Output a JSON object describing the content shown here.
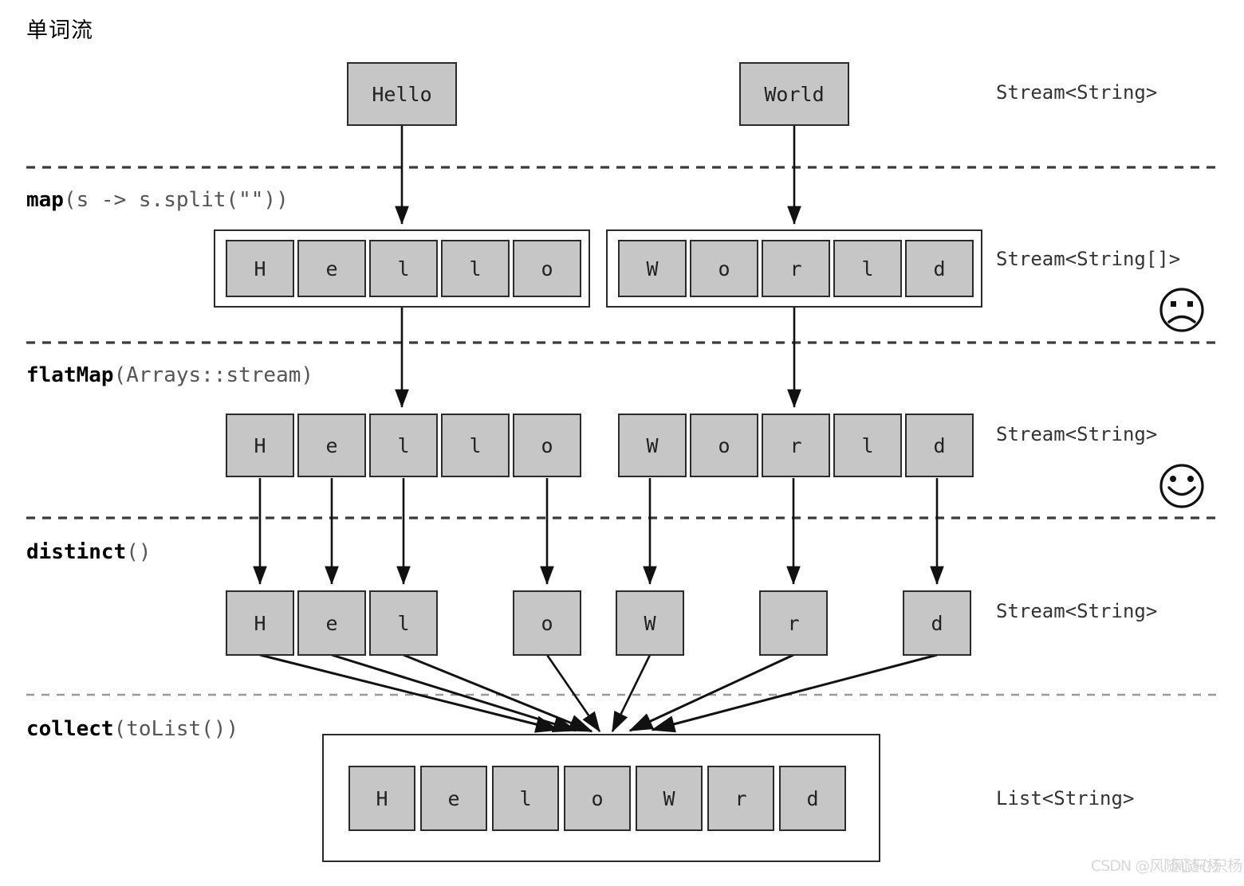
{
  "title": "单词流",
  "stages": [
    {
      "id": "source",
      "fn": "",
      "args": "",
      "type_label": "Stream<String>",
      "face": "none"
    },
    {
      "id": "map",
      "fn": "map",
      "args": "(s -> s.split(\"\"))",
      "type_label": "Stream<String[]>",
      "face": "sad"
    },
    {
      "id": "flatmap",
      "fn": "flatMap",
      "args": "(Arrays::stream)",
      "type_label": "Stream<String>",
      "face": "happy"
    },
    {
      "id": "distinct",
      "fn": "distinct",
      "args": "()",
      "type_label": "Stream<String>",
      "face": "none"
    },
    {
      "id": "collect",
      "fn": "collect",
      "args": "(toList())",
      "type_label": "List<String>",
      "face": "none"
    }
  ],
  "source_words": [
    {
      "text": "Hello"
    },
    {
      "text": "World"
    }
  ],
  "map_arrays": [
    {
      "chars": [
        "H",
        "e",
        "l",
        "l",
        "o"
      ]
    },
    {
      "chars": [
        "W",
        "o",
        "r",
        "l",
        "d"
      ]
    }
  ],
  "flatmap_chars": [
    "H",
    "e",
    "l",
    "l",
    "o",
    "W",
    "o",
    "r",
    "l",
    "d"
  ],
  "distinct_chars": [
    "H",
    "e",
    "l",
    "o",
    "W",
    "r",
    "d"
  ],
  "collect_chars": [
    "H",
    "e",
    "l",
    "o",
    "W",
    "r",
    "d"
  ],
  "watermark": {
    "line1": "CSDN @风随心只杨",
    "line2": "风随心只杨"
  },
  "colors": {
    "cell_fill": "#c6c6c6",
    "cell_stroke": "#2b2b2b",
    "divider": "#3a3a3a",
    "divider_last": "#9a9a9a",
    "text": "#222222",
    "type_text": "#333333",
    "arg_text": "#555555"
  }
}
